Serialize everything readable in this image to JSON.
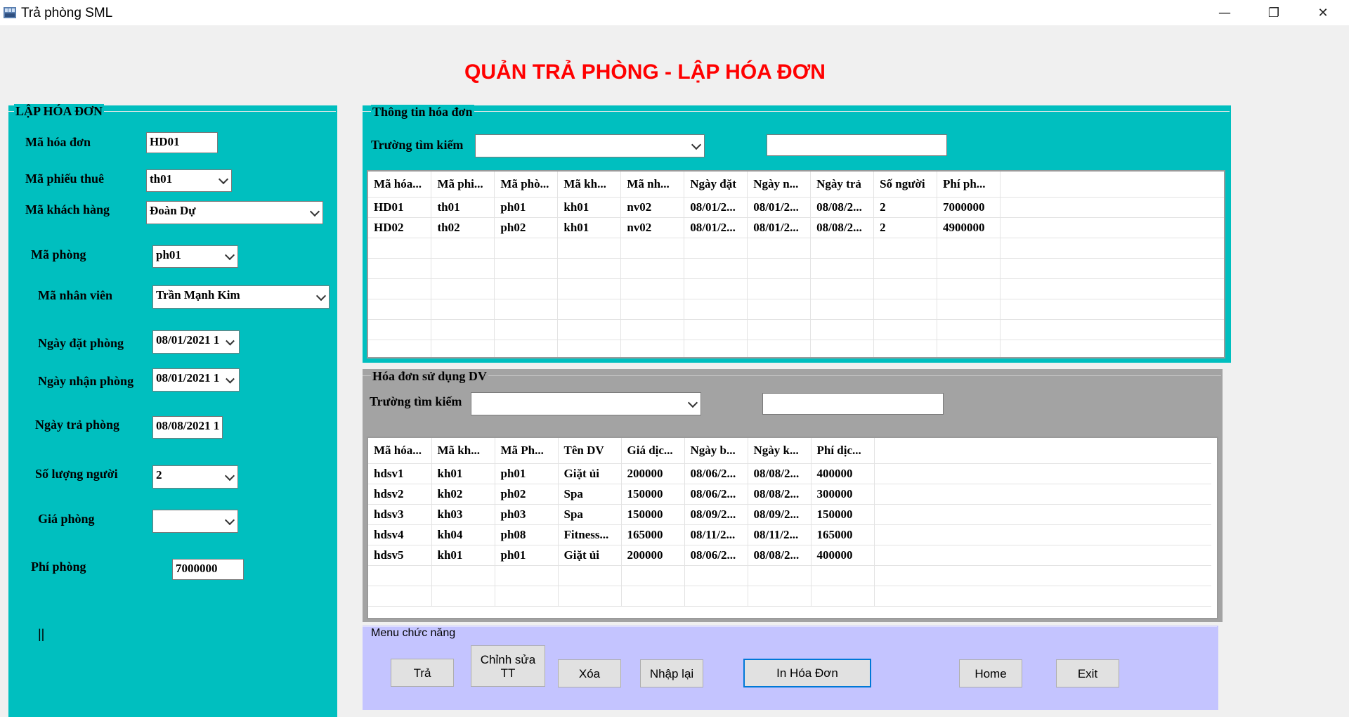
{
  "window": {
    "title": "Trả phòng SML",
    "minimize_glyph": "—",
    "restore_glyph": "❐",
    "close_glyph": "✕"
  },
  "page_title": "QUẢN TRẢ PHÒNG - LẬP HÓA ĐƠN",
  "colors": {
    "teal": "#00bfbf",
    "gray_panel": "#a3a3a3",
    "menu_panel": "#c4c4ff",
    "title_red": "#ff0000"
  },
  "invoice_form": {
    "group_title": "LẬP HÓA ĐƠN",
    "ma_hoa_don": {
      "label": "Mã hóa đơn",
      "value": "HD01"
    },
    "ma_phieu_thue": {
      "label": "Mã phiếu thuê",
      "value": "th01"
    },
    "ma_khach_hang": {
      "label": "Mã khách hàng",
      "value": "Đoàn Dự"
    },
    "ma_phong": {
      "label": "Mã phòng",
      "value": "ph01"
    },
    "ma_nhan_vien": {
      "label": "Mã nhân viên",
      "value": "Trần Mạnh Kim"
    },
    "ngay_dat_phong": {
      "label": "Ngày đặt phòng",
      "value": "08/01/2021 1"
    },
    "ngay_nhan_phong": {
      "label": "Ngày nhận phòng",
      "value": "08/01/2021 1"
    },
    "ngay_tra_phong": {
      "label": "Ngày trả phòng",
      "value": "08/08/2021 1"
    },
    "so_luong_nguoi": {
      "label": "Số lượng người",
      "value": "2"
    },
    "gia_phong": {
      "label": "Giá phòng",
      "value": ""
    },
    "phi_phong": {
      "label": "Phí phòng",
      "value": "7000000"
    },
    "stray_mark": "||"
  },
  "invoice_info": {
    "group_title": "Thông tin hóa đơn",
    "search_label": "Trường tìm kiếm",
    "search_field_value": "",
    "search_text_value": "",
    "columns": [
      "Mã hóa...",
      "Mã phi...",
      "Mã phò...",
      "Mã kh...",
      "Mã nh...",
      "Ngày đặt",
      "Ngày n...",
      "Ngày trả",
      "Số người",
      "Phí ph..."
    ],
    "rows": [
      [
        "HD01",
        "th01",
        "ph01",
        "kh01",
        "nv02",
        "08/01/2...",
        "08/01/2...",
        "08/08/2...",
        "2",
        "7000000"
      ],
      [
        "HD02",
        "th02",
        "ph02",
        "kh01",
        "nv02",
        "08/01/2...",
        "08/01/2...",
        "08/08/2...",
        "2",
        "4900000"
      ]
    ]
  },
  "service_invoice": {
    "group_title": "Hóa đơn sử dụng DV",
    "search_label": "Trường tìm kiếm",
    "search_field_value": "",
    "search_text_value": "",
    "columns": [
      "Mã hóa...",
      "Mã kh...",
      "Mã Ph...",
      "Tên DV",
      "Giá dịc...",
      "Ngày b...",
      "Ngày k...",
      "Phí dịc..."
    ],
    "rows": [
      [
        "hdsv1",
        "kh01",
        "ph01",
        "Giặt ủi",
        "200000",
        "08/06/2...",
        "08/08/2...",
        "400000"
      ],
      [
        "hdsv2",
        "kh02",
        "ph02",
        "Spa",
        "150000",
        "08/06/2...",
        "08/08/2...",
        "300000"
      ],
      [
        "hdsv3",
        "kh03",
        "ph03",
        "Spa",
        "150000",
        "08/09/2...",
        "08/09/2...",
        "150000"
      ],
      [
        "hdsv4",
        "kh04",
        "ph08",
        "Fitness...",
        "165000",
        "08/11/2...",
        "08/11/2...",
        "165000"
      ],
      [
        "hdsv5",
        "kh01",
        "ph01",
        "Giặt ủi",
        "200000",
        "08/06/2...",
        "08/08/2...",
        "400000"
      ]
    ]
  },
  "menu": {
    "group_title": "Menu chức năng",
    "tra": "Trả",
    "chinh_sua_line1": "Chỉnh sửa",
    "chinh_sua_line2": "TT",
    "xoa": "Xóa",
    "nhap_lai": "Nhập lại",
    "in_hoa_don": "In Hóa Đơn",
    "home": "Home",
    "exit": "Exit"
  }
}
